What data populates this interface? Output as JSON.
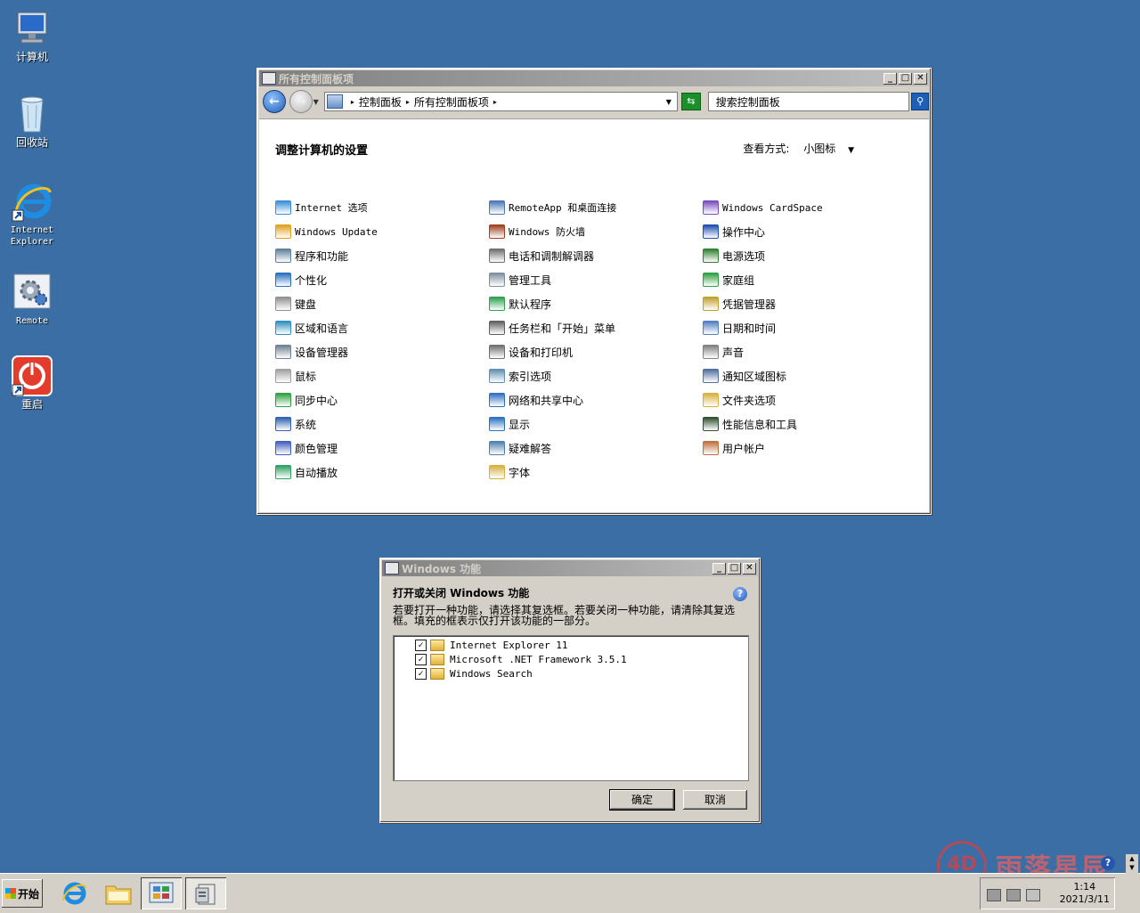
{
  "desktop": {
    "icons": [
      {
        "label": "计算机",
        "icon": "computer-icon"
      },
      {
        "label": "回收站",
        "icon": "recycle-bin-icon"
      },
      {
        "label": "Internet Explorer",
        "icon": "ie-icon"
      },
      {
        "label": "Remote",
        "icon": "remote-gear-icon"
      },
      {
        "label": "重启",
        "icon": "power-icon"
      }
    ]
  },
  "control_panel": {
    "title": "所有控制面板项",
    "breadcrumb": [
      "控制面板",
      "所有控制面板项"
    ],
    "search_placeholder": "搜索控制面板",
    "heading": "调整计算机的设置",
    "view_by_label": "查看方式:",
    "view_by_value": "小图标",
    "items": [
      {
        "label": "Internet 选项",
        "icon": "internet-options-icon",
        "color": "#3a8fd8"
      },
      {
        "label": "RemoteApp 和桌面连接",
        "icon": "remoteapp-icon",
        "color": "#4a78b8"
      },
      {
        "label": "Windows CardSpace",
        "icon": "cardspace-icon",
        "color": "#7a4cc0"
      },
      {
        "label": "Windows Update",
        "icon": "windows-update-icon",
        "color": "#e0a020"
      },
      {
        "label": "Windows 防火墙",
        "icon": "firewall-icon",
        "color": "#a04020"
      },
      {
        "label": "操作中心",
        "icon": "action-center-flag-icon",
        "color": "#2050b0"
      },
      {
        "label": "程序和功能",
        "icon": "programs-icon",
        "color": "#6080a0"
      },
      {
        "label": "电话和调制解调器",
        "icon": "phone-modem-icon",
        "color": "#707070"
      },
      {
        "label": "电源选项",
        "icon": "power-options-icon",
        "color": "#308030"
      },
      {
        "label": "个性化",
        "icon": "personalization-icon",
        "color": "#2a70c0"
      },
      {
        "label": "管理工具",
        "icon": "admin-tools-icon",
        "color": "#8090a0"
      },
      {
        "label": "家庭组",
        "icon": "homegroup-icon",
        "color": "#30a040"
      },
      {
        "label": "键盘",
        "icon": "keyboard-icon",
        "color": "#909090"
      },
      {
        "label": "默认程序",
        "icon": "default-programs-icon",
        "color": "#30a050"
      },
      {
        "label": "凭据管理器",
        "icon": "credential-manager-icon",
        "color": "#c0a030"
      },
      {
        "label": "区域和语言",
        "icon": "region-language-icon",
        "color": "#3090c0"
      },
      {
        "label": "任务栏和「开始」菜单",
        "icon": "taskbar-start-icon",
        "color": "#606060"
      },
      {
        "label": "日期和时间",
        "icon": "date-time-icon",
        "color": "#5080c0"
      },
      {
        "label": "设备管理器",
        "icon": "device-manager-icon",
        "color": "#708090"
      },
      {
        "label": "设备和打印机",
        "icon": "devices-printers-icon",
        "color": "#707070"
      },
      {
        "label": "声音",
        "icon": "sound-icon",
        "color": "#808080"
      },
      {
        "label": "鼠标",
        "icon": "mouse-icon",
        "color": "#a0a0a0"
      },
      {
        "label": "索引选项",
        "icon": "indexing-icon",
        "color": "#6090b0"
      },
      {
        "label": "通知区域图标",
        "icon": "notification-area-icon",
        "color": "#5070a0"
      },
      {
        "label": "同步中心",
        "icon": "sync-center-icon",
        "color": "#30a040"
      },
      {
        "label": "网络和共享中心",
        "icon": "network-sharing-icon",
        "color": "#3070c0"
      },
      {
        "label": "文件夹选项",
        "icon": "folder-options-icon",
        "color": "#d8b040"
      },
      {
        "label": "系统",
        "icon": "system-icon",
        "color": "#3060b0"
      },
      {
        "label": "显示",
        "icon": "display-icon",
        "color": "#2a70c0"
      },
      {
        "label": "性能信息和工具",
        "icon": "performance-icon",
        "color": "#305030"
      },
      {
        "label": "颜色管理",
        "icon": "color-management-icon",
        "color": "#4060c0"
      },
      {
        "label": "疑难解答",
        "icon": "troubleshooting-icon",
        "color": "#5080b0"
      },
      {
        "label": "用户帐户",
        "icon": "user-accounts-icon",
        "color": "#c07040"
      },
      {
        "label": "自动播放",
        "icon": "autoplay-icon",
        "color": "#30a060"
      },
      {
        "label": "字体",
        "icon": "fonts-icon",
        "color": "#d8b040"
      }
    ]
  },
  "features_dialog": {
    "title": "Windows 功能",
    "heading": "打开或关闭 Windows 功能",
    "description": "若要打开一种功能，请选择其复选框。若要关闭一种功能，请清除其复选框。填充的框表示仅打开该功能的一部分。",
    "features": [
      {
        "label": "Internet Explorer 11",
        "checked": true
      },
      {
        "label": "Microsoft .NET Framework 3.5.1",
        "checked": true
      },
      {
        "label": "Windows Search",
        "checked": true
      }
    ],
    "ok_label": "确定",
    "cancel_label": "取消"
  },
  "taskbar": {
    "start_label": "开始",
    "apps": [
      "ie-icon",
      "explorer-folder-icon",
      "control-panel-icon",
      "windows-features-icon"
    ],
    "time": "1:14",
    "date": "2021/3/11"
  },
  "watermark": {
    "text": "雨落星辰"
  },
  "colors": {
    "desktop": "#3a6ea5",
    "title_active_start": "#0a246a",
    "title_active_end": "#a6caf0",
    "face": "#d4d0c8"
  }
}
